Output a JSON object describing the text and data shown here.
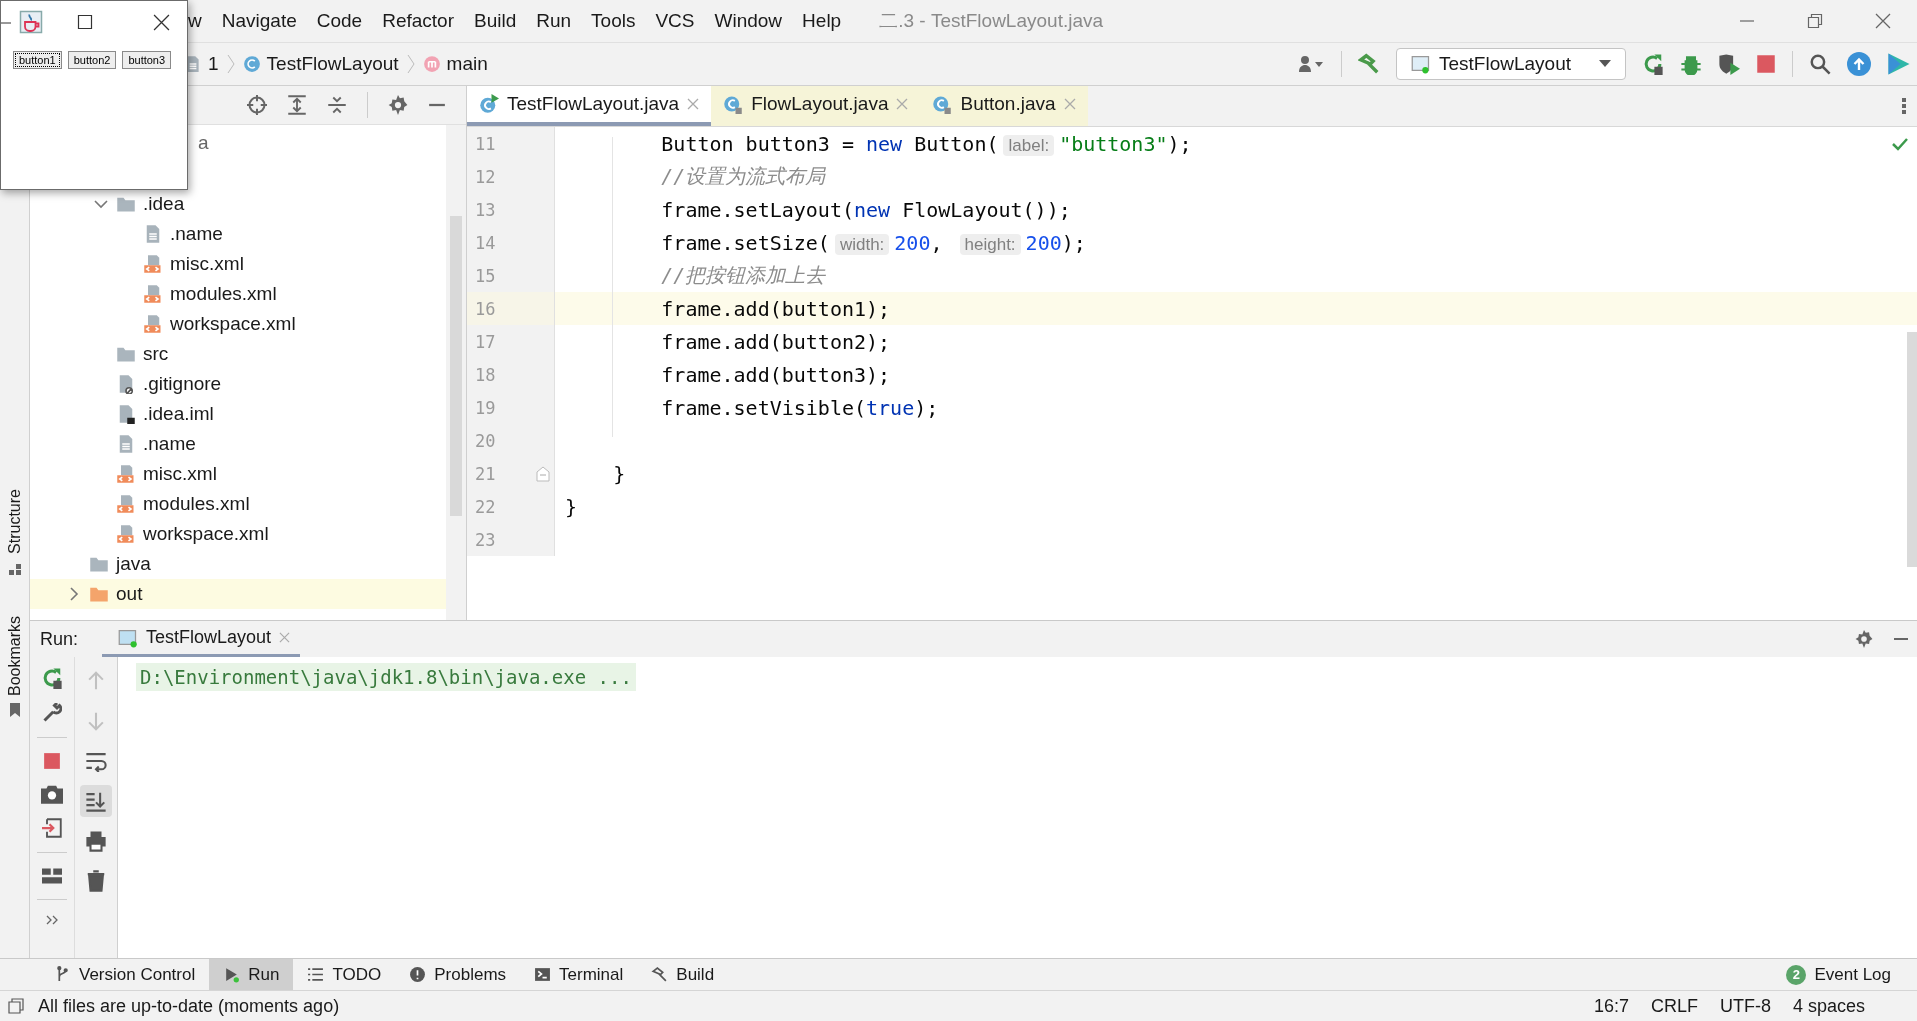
{
  "java_window": {
    "buttons": [
      {
        "label": "button1",
        "focused": true
      },
      {
        "label": "button2",
        "focused": false
      },
      {
        "label": "button3",
        "focused": false
      }
    ]
  },
  "menu": [
    "w",
    "Navigate",
    "Code",
    "Refactor",
    "Build",
    "Run",
    "Tools",
    "VCS",
    "Window",
    "Help"
  ],
  "window_title": "二.3 - TestFlowLayout.java",
  "breadcrumb": [
    {
      "label": "1",
      "kind": "text"
    },
    {
      "label": "TestFlowLayout",
      "kind": "class"
    },
    {
      "label": "main",
      "kind": "method"
    }
  ],
  "run_configuration": "TestFlowLayout",
  "project_tree": [
    {
      "label": "a",
      "kind": "cut",
      "selected": false,
      "children": [
        {
          "label": ".idea",
          "kind": "folder",
          "expanded": true,
          "selected": false,
          "children": [
            {
              "label": ".name",
              "kind": "text",
              "selected": false
            },
            {
              "label": "misc.xml",
              "kind": "xml",
              "selected": false
            },
            {
              "label": "modules.xml",
              "kind": "xml",
              "selected": false
            },
            {
              "label": "workspace.xml",
              "kind": "xml",
              "selected": false
            }
          ]
        },
        {
          "label": "src",
          "kind": "folder",
          "selected": false
        },
        {
          "label": ".gitignore",
          "kind": "gitignore",
          "selected": false
        },
        {
          "label": ".idea.iml",
          "kind": "iml",
          "selected": false
        },
        {
          "label": ".name",
          "kind": "text",
          "selected": false
        },
        {
          "label": "misc.xml",
          "kind": "xml",
          "selected": false
        },
        {
          "label": "modules.xml",
          "kind": "xml",
          "selected": false
        },
        {
          "label": "workspace.xml",
          "kind": "xml",
          "selected": false
        }
      ]
    },
    {
      "label": "java",
      "kind": "folder",
      "selected": false
    },
    {
      "label": "out",
      "kind": "excluded-folder",
      "expanded": false,
      "selected": true
    }
  ],
  "editor": {
    "tabs": [
      {
        "label": "TestFlowLayout.java",
        "kind": "runnable",
        "selected": true
      },
      {
        "label": "FlowLayout.java",
        "kind": "library",
        "selected": false
      },
      {
        "label": "Button.java",
        "kind": "library",
        "selected": false
      }
    ],
    "lines": [
      {
        "number": "11",
        "current": false,
        "segments": [
          {
            "kind": "plain",
            "text": "        Button button3 = "
          },
          {
            "kind": "keyword",
            "text": "new"
          },
          {
            "kind": "plain",
            "text": " Button("
          },
          {
            "kind": "hint",
            "text": "label:"
          },
          {
            "kind": "string",
            "text": "\"button3\""
          },
          {
            "kind": "plain",
            "text": ");"
          }
        ]
      },
      {
        "number": "12",
        "current": false,
        "segments": [
          {
            "kind": "comment",
            "text": "        //设置为流式布局"
          }
        ]
      },
      {
        "number": "13",
        "current": false,
        "segments": [
          {
            "kind": "plain",
            "text": "        frame.setLayout("
          },
          {
            "kind": "keyword",
            "text": "new"
          },
          {
            "kind": "plain",
            "text": " FlowLayout());"
          }
        ]
      },
      {
        "number": "14",
        "current": false,
        "segments": [
          {
            "kind": "plain",
            "text": "        frame.setSize("
          },
          {
            "kind": "hint",
            "text": "width:"
          },
          {
            "kind": "number",
            "text": "200"
          },
          {
            "kind": "plain",
            "text": ", "
          },
          {
            "kind": "hint",
            "text": "height:"
          },
          {
            "kind": "number",
            "text": "200"
          },
          {
            "kind": "plain",
            "text": ");"
          }
        ]
      },
      {
        "number": "15",
        "current": false,
        "segments": [
          {
            "kind": "comment",
            "text": "        //把按钮添加上去"
          }
        ]
      },
      {
        "number": "16",
        "current": true,
        "segments": [
          {
            "kind": "plain",
            "text": "        frame.add(button1);"
          }
        ]
      },
      {
        "number": "17",
        "current": false,
        "segments": [
          {
            "kind": "plain",
            "text": "        frame.add(button2);"
          }
        ]
      },
      {
        "number": "18",
        "current": false,
        "segments": [
          {
            "kind": "plain",
            "text": "        frame.add(button3);"
          }
        ]
      },
      {
        "number": "19",
        "current": false,
        "segments": [
          {
            "kind": "plain",
            "text": "        frame.setVisible("
          },
          {
            "kind": "keyword",
            "text": "true"
          },
          {
            "kind": "plain",
            "text": ");"
          }
        ]
      },
      {
        "number": "20",
        "current": false
      },
      {
        "number": "21",
        "current": false,
        "fold": true,
        "segments": [
          {
            "kind": "plain",
            "text": "    }"
          }
        ]
      },
      {
        "number": "22",
        "current": false,
        "segments": [
          {
            "kind": "plain",
            "text": "}"
          }
        ]
      },
      {
        "number": "23",
        "current": false
      }
    ]
  },
  "run_panel": {
    "title": "Run:",
    "tab": "TestFlowLayout",
    "console": [
      "D:\\Environment\\java\\jdk1.8\\bin\\java.exe ..."
    ],
    "console_tools": [
      {
        "kind": "up",
        "selected": false,
        "disabled": true
      },
      {
        "kind": "down",
        "selected": false,
        "disabled": true
      },
      {
        "kind": "wrap",
        "selected": false,
        "disabled": false
      },
      {
        "kind": "scroll-end",
        "selected": true,
        "disabled": false
      },
      {
        "kind": "print",
        "selected": false,
        "disabled": false
      },
      {
        "kind": "trash",
        "selected": false,
        "disabled": false
      }
    ]
  },
  "side_tabs": [
    {
      "label": "Structure",
      "kind": "structure"
    },
    {
      "label": "Bookmarks",
      "kind": "bookmark"
    }
  ],
  "tool_windows": [
    {
      "label": "Version Control",
      "kind": "branch",
      "selected": false
    },
    {
      "label": "Run",
      "kind": "run",
      "selected": true
    },
    {
      "label": "TODO",
      "kind": "list",
      "selected": false
    },
    {
      "label": "Problems",
      "kind": "warning",
      "selected": false
    },
    {
      "label": "Terminal",
      "kind": "terminal",
      "selected": false
    },
    {
      "label": "Build",
      "kind": "hammer",
      "selected": false
    }
  ],
  "event_log": {
    "badge": "2",
    "label": "Event Log"
  },
  "status_bar": {
    "message": "All files are up-to-date (moments ago)",
    "items": [
      "16:7",
      "CRLF",
      "UTF-8",
      "4 spaces"
    ]
  }
}
